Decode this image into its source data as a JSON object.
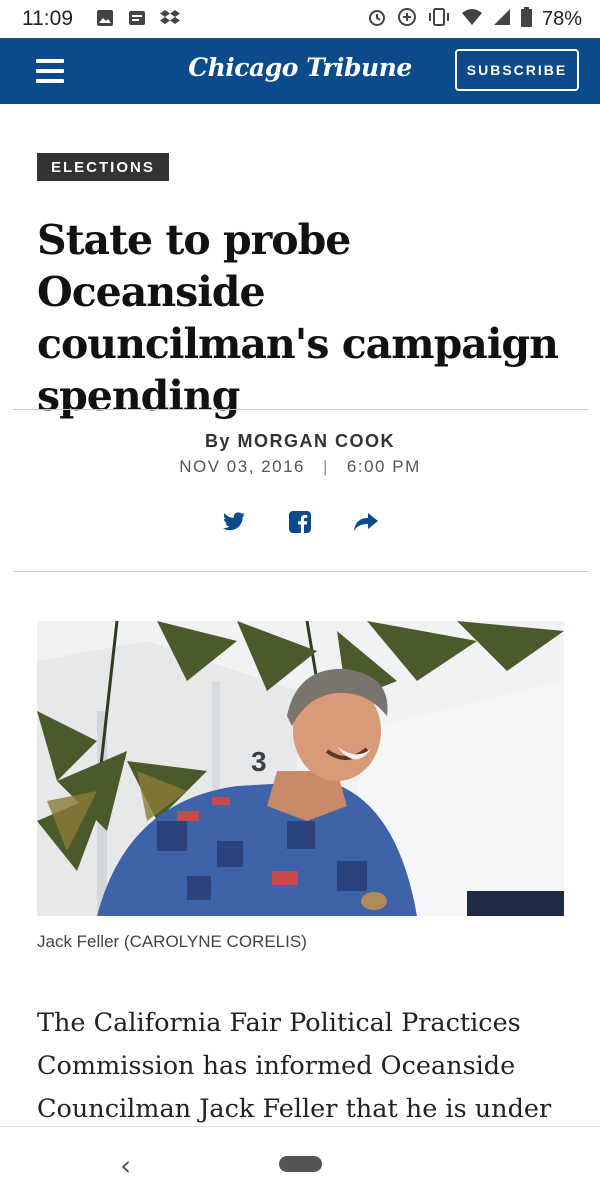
{
  "status_bar": {
    "time": "11:09",
    "battery": "78%",
    "left_icons": [
      "image-icon",
      "message-icon",
      "dropbox-icon"
    ],
    "right_icons": [
      "alarm-icon",
      "data-saver-icon",
      "vibrate-icon",
      "wifi-icon",
      "signal-icon",
      "battery-icon"
    ]
  },
  "header": {
    "logo": "Chicago Tribune",
    "subscribe_label": "SUBSCRIBE",
    "background": "#0b4a8b"
  },
  "article": {
    "section": "ELECTIONS",
    "headline": "State to probe Oceanside councilman's campaign spending",
    "byline": "By MORGAN COOK",
    "date": "NOV 03, 2016",
    "date_separator": "|",
    "time": "6:00 PM",
    "share_icons": [
      "twitter-icon",
      "facebook-icon",
      "share-arrow-icon"
    ],
    "photo_caption": "Jack Feller (CAROLYNE CORELIS)",
    "body": "The California Fair Political Practices Commission has informed Oceanside Councilman Jack Feller that he is under"
  },
  "nav_bar": {
    "back_icon": "back-chevron-icon",
    "home_icon": "home-pill-icon"
  }
}
